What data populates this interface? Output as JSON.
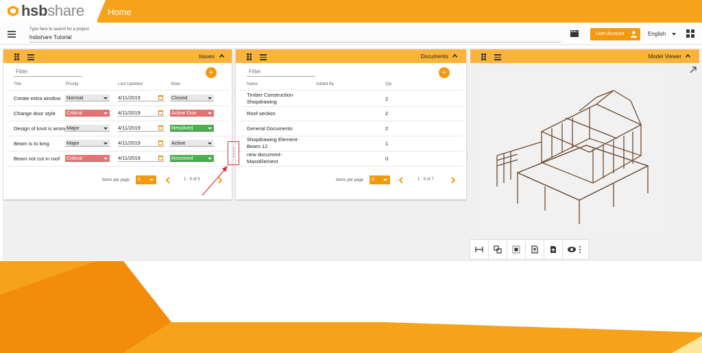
{
  "app": {
    "logo_main": "hsb",
    "logo_sub": "share",
    "page_title": "Home"
  },
  "search": {
    "hint": "Type here to search for a project.",
    "value": "hsbshare Tutorial"
  },
  "header": {
    "user_button": "User Account",
    "language": "English"
  },
  "issues": {
    "title": "Issues",
    "filter_placeholder": "Filter",
    "columns": [
      "Title",
      "Priority",
      "Last Updated",
      "State"
    ],
    "rows": [
      {
        "title": "Create extra window",
        "priority": "Normal",
        "updated": "4/11/2019",
        "state": "Closed"
      },
      {
        "title": "Change door style",
        "priority": "Critical",
        "updated": "4/11/2019",
        "state": "Active Due"
      },
      {
        "title": "Design of knot is wrong",
        "priority": "Major",
        "updated": "4/11/2019",
        "state": "Resolved"
      },
      {
        "title": "Beam is to long",
        "priority": "Major",
        "updated": "4/11/2019",
        "state": "Active"
      },
      {
        "title": "Beam not cut in roof",
        "priority": "Critical",
        "updated": "4/11/2019",
        "state": "Resolved"
      }
    ],
    "items_per_page_label": "Items per page",
    "items_per_page": "5",
    "range": "1 - 5 of 5"
  },
  "documents": {
    "title": "Documents",
    "filter_placeholder": "Filter",
    "columns": [
      "Name",
      "Added By",
      "Qty"
    ],
    "rows": [
      {
        "name_1": "Timber Construction",
        "name_2": "Shopdrawing",
        "qty": "2"
      },
      {
        "name_1": "Roof section",
        "name_2": "",
        "qty": "2"
      },
      {
        "name_1": "General Documents",
        "name_2": "",
        "qty": "2"
      },
      {
        "name_1": "Shopdrawing Element-",
        "name_2": "Beam-12",
        "qty": "1"
      },
      {
        "name_1": "new document-",
        "name_2": "MassElement",
        "qty": "0"
      }
    ],
    "items_per_page_label": "Items per page",
    "items_per_page": "5",
    "range": "1 - 5 of 7"
  },
  "viewer": {
    "title": "Model Viewer"
  },
  "colors": {
    "brand": "#f7a21b",
    "button": "#f29a0e",
    "panel_header": "#fbb43a",
    "critical": "#e57373",
    "resolved": "#4caf50",
    "annotation": "#d32f2f"
  },
  "icons": [
    "menu-icon",
    "clapperboard-icon",
    "person-icon",
    "grid-icon",
    "drag-handle-icon",
    "chevron-up-icon",
    "plus-icon",
    "calendar-icon",
    "chevron-left-icon",
    "chevron-right-icon",
    "expand-icon",
    "measure-icon",
    "section-icon",
    "select-icon",
    "export-icon",
    "add-file-icon",
    "eye-icon"
  ]
}
